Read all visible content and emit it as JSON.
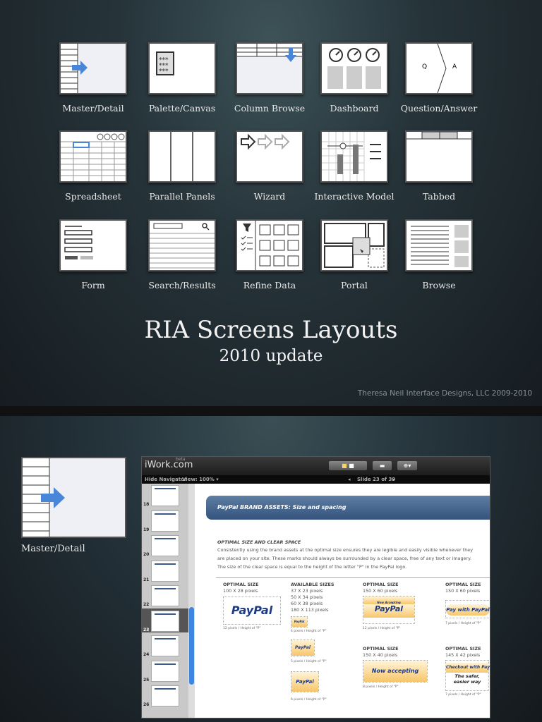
{
  "slide1": {
    "layouts": [
      {
        "label": "Master/Detail",
        "icon": "master-detail"
      },
      {
        "label": "Palette/Canvas",
        "icon": "palette-canvas"
      },
      {
        "label": "Column Browse",
        "icon": "column-browse"
      },
      {
        "label": "Dashboard",
        "icon": "dashboard"
      },
      {
        "label": "Question/Answer",
        "icon": "question-answer",
        "q": "Q",
        "a": "A"
      },
      {
        "label": "Spreadsheet",
        "icon": "spreadsheet"
      },
      {
        "label": "Parallel Panels",
        "icon": "parallel-panels"
      },
      {
        "label": "Wizard",
        "icon": "wizard"
      },
      {
        "label": "Interactive Model",
        "icon": "interactive-model"
      },
      {
        "label": "Tabbed",
        "icon": "tabbed"
      },
      {
        "label": "Form",
        "icon": "form"
      },
      {
        "label": "Search/Results",
        "icon": "search-results"
      },
      {
        "label": "Refine Data",
        "icon": "refine-data"
      },
      {
        "label": "Portal",
        "icon": "portal"
      },
      {
        "label": "Browse",
        "icon": "browse"
      }
    ],
    "title": "RIA Screens Layouts",
    "subtitle": "2010 update",
    "credit": "Theresa Neil Interface Designs, LLC 2009-2010"
  },
  "slide2": {
    "layout_label": "Master/Detail",
    "iwork": {
      "logo": "iWork.com",
      "beta": "beta",
      "hide_navigator": "Hide Navigator",
      "view": "View: 100% ▾",
      "slide_indicator": "Slide 23 of 39",
      "thumb_numbers": [
        "18",
        "19",
        "20",
        "21",
        "22",
        "23",
        "24",
        "25",
        "26"
      ],
      "doc": {
        "banner": "PayPal BRAND ASSETS: Size and spacing",
        "heading": "OPTIMAL SIZE AND CLEAR SPACE",
        "lines": [
          "Consistently using the brand assets at the optimal size ensures they are legible and easily visible whenever they",
          "are placed on your site. These marks should always be surrounded by a clear space, free of any text or imagery.",
          "The size of the clear space is equal to the height of the letter \"P\" in the PayPal logo."
        ],
        "col1": {
          "title": "OPTIMAL SIZE",
          "size": "100 X 28 pixels",
          "logo": "PayPal",
          "note": "12 pixels / Height of \"P\""
        },
        "col2": {
          "title": "AVAILABLE SIZES",
          "sizes": [
            "37 X 23 pixels",
            "50 X 34 pixels",
            "60 X 38 pixels",
            "180 X 113 pixels"
          ],
          "logo": "PayPal",
          "notes": [
            "4 pixels / Height of \"P\"",
            "5 pixels / Height of \"P\"",
            "6 pixels / Height of \"P\""
          ]
        },
        "col3": {
          "title": "OPTIMAL SIZE",
          "size": "150 X 60 pixels",
          "top_text": "Now Accepting",
          "logo": "PayPal",
          "note": "12 pixels / Height of \"P\"",
          "title2": "OPTIMAL SIZE",
          "size2": "150 X 40 pixels",
          "text2": "Now accepting",
          "note2": "8 pixels / Height of \"P\""
        },
        "col4": {
          "title": "OPTIMAL SIZE",
          "size": "150 X 60 pixels",
          "btn": "Pay with PayPal",
          "note": "7 pixels / Height of \"P\"",
          "title2": "OPTIMAL SIZE",
          "size2": "145 X 42 pixels",
          "btn2": "Checkout with PayPal",
          "sub2": "The safer, easier way",
          "note2": "7 pixels / Height of \"P\""
        }
      }
    }
  }
}
